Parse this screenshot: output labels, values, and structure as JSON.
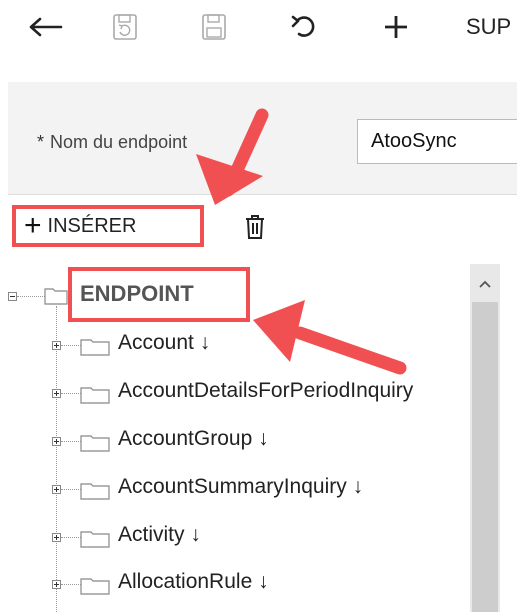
{
  "toolbar": {
    "back_icon": "arrow-left-icon",
    "discard_icon": "discard-save-icon",
    "save_icon": "save-icon",
    "undo_icon": "undo-icon",
    "add_icon": "plus-icon",
    "sup_label": "SUP"
  },
  "form": {
    "required_marker": "*",
    "endpoint_name_label": "Nom du endpoint",
    "endpoint_name_value": "AtooSync"
  },
  "tree_toolbar": {
    "insert_label": "INSÉRER",
    "insert_icon": "plus-icon",
    "delete_icon": "trash-icon"
  },
  "tree": {
    "root": {
      "label": "ENDPOINT",
      "icon": "folder-icon"
    },
    "children": [
      {
        "label": "Account ↓"
      },
      {
        "label": "AccountDetailsForPeriodInquiry"
      },
      {
        "label": "AccountGroup ↓"
      },
      {
        "label": "AccountSummaryInquiry ↓"
      },
      {
        "label": "Activity ↓"
      },
      {
        "label": "AllocationRule ↓"
      }
    ]
  },
  "annotation_color": "#f05052"
}
